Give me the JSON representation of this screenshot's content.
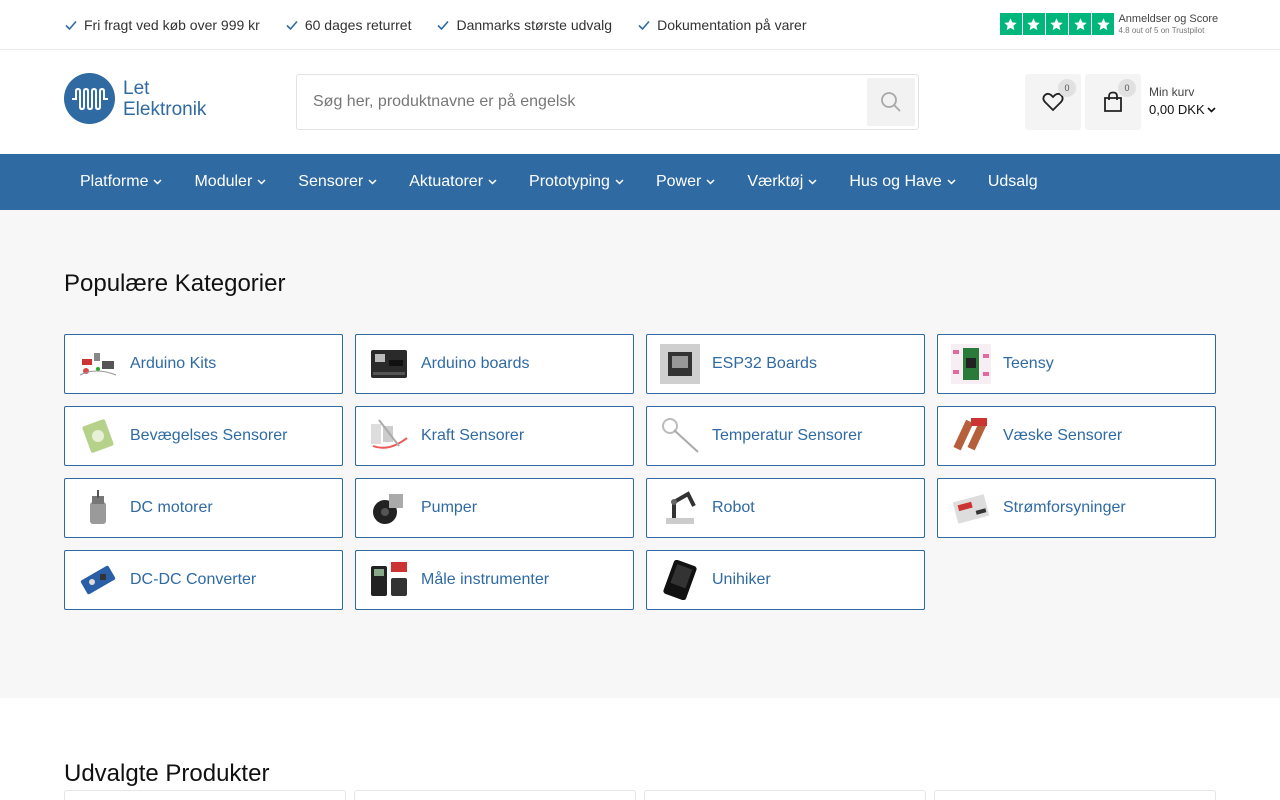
{
  "topbar": {
    "usps": [
      "Fri fragt ved køb over 999 kr",
      "60 dages returret",
      "Danmarks største udvalg",
      "Dokumentation på varer"
    ],
    "trustpilot": {
      "title": "Anmeldser og Score",
      "subtitle": "4.8 out of 5 on Trustpilot",
      "stars": 5,
      "color": "#00b67a"
    }
  },
  "header": {
    "logo_line1": "Let",
    "logo_line2": "Elektronik",
    "search_placeholder": "Søg her, produktnavne er på engelsk",
    "wishlist_count": "0",
    "cart_count": "0",
    "cart_label": "Min kurv",
    "cart_total": "0,00 DKK"
  },
  "nav": {
    "items": [
      {
        "label": "Platforme",
        "dropdown": true
      },
      {
        "label": "Moduler",
        "dropdown": true
      },
      {
        "label": "Sensorer",
        "dropdown": true
      },
      {
        "label": "Aktuatorer",
        "dropdown": true
      },
      {
        "label": "Prototyping",
        "dropdown": true
      },
      {
        "label": "Power",
        "dropdown": true
      },
      {
        "label": "Værktøj",
        "dropdown": true
      },
      {
        "label": "Hus og Have",
        "dropdown": true
      },
      {
        "label": "Udsalg",
        "dropdown": false
      }
    ]
  },
  "categories": {
    "title": "Populære Kategorier",
    "items": [
      {
        "label": "Arduino Kits",
        "icon": "arduino-kit-icon"
      },
      {
        "label": "Arduino boards",
        "icon": "arduino-board-icon"
      },
      {
        "label": "ESP32 Boards",
        "icon": "esp32-board-icon"
      },
      {
        "label": "Teensy",
        "icon": "teensy-icon"
      },
      {
        "label": "Bevægelses Sensorer",
        "icon": "motion-sensor-icon"
      },
      {
        "label": "Kraft Sensorer",
        "icon": "force-sensor-icon"
      },
      {
        "label": "Temperatur Sensorer",
        "icon": "temperature-sensor-icon"
      },
      {
        "label": "Væske Sensorer",
        "icon": "liquid-sensor-icon"
      },
      {
        "label": "DC motorer",
        "icon": "dc-motor-icon"
      },
      {
        "label": "Pumper",
        "icon": "pump-icon"
      },
      {
        "label": "Robot",
        "icon": "robot-arm-icon"
      },
      {
        "label": "Strømforsyninger",
        "icon": "power-supply-icon"
      },
      {
        "label": "DC-DC Converter",
        "icon": "dc-dc-converter-icon"
      },
      {
        "label": "Måle instrumenter",
        "icon": "multimeter-icon"
      },
      {
        "label": "Unihiker",
        "icon": "unihiker-icon"
      }
    ]
  },
  "featured": {
    "title": "Udvalgte Produkter"
  },
  "colors": {
    "brand": "#2f6aa3",
    "category_background": "#f7f7f7"
  }
}
